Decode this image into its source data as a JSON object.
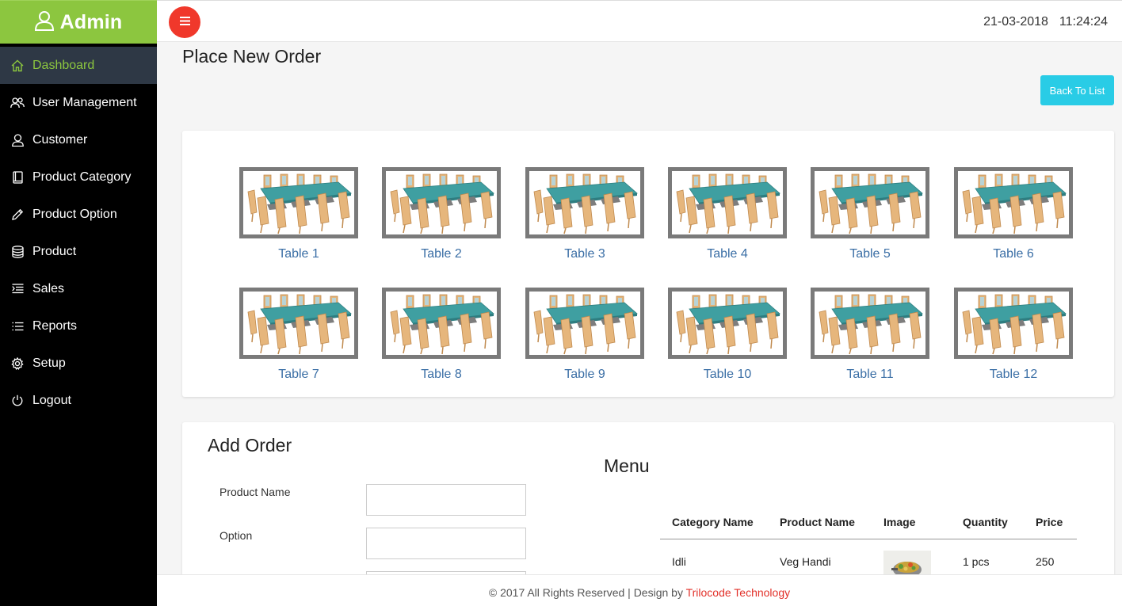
{
  "app": {
    "brand": "Admin"
  },
  "sidebar": {
    "items": [
      {
        "label": "Dashboard",
        "icon": "home-icon",
        "active": true
      },
      {
        "label": "User Management",
        "icon": "users-icon"
      },
      {
        "label": "Customer",
        "icon": "user-icon"
      },
      {
        "label": "Product Category",
        "icon": "book-icon"
      },
      {
        "label": "Product Option",
        "icon": "pencil-icon"
      },
      {
        "label": "Product",
        "icon": "database-icon"
      },
      {
        "label": "Sales",
        "icon": "list-indent-icon"
      },
      {
        "label": "Reports",
        "icon": "list-icon"
      },
      {
        "label": "Setup",
        "icon": "gear-icon"
      },
      {
        "label": "Logout",
        "icon": "power-icon"
      }
    ]
  },
  "header": {
    "date": "21-03-2018",
    "time": "11:24:24"
  },
  "page": {
    "title": "Place New Order",
    "back_button": "Back To List"
  },
  "tables": [
    {
      "label": "Table 1"
    },
    {
      "label": "Table 2"
    },
    {
      "label": "Table 3"
    },
    {
      "label": "Table 4"
    },
    {
      "label": "Table 5"
    },
    {
      "label": "Table 6"
    },
    {
      "label": "Table 7"
    },
    {
      "label": "Table 8"
    },
    {
      "label": "Table 9"
    },
    {
      "label": "Table 10"
    },
    {
      "label": "Table 11"
    },
    {
      "label": "Table 12"
    }
  ],
  "add_order": {
    "title": "Add Order",
    "fields": [
      {
        "label": "Product Name",
        "value": ""
      },
      {
        "label": "Option",
        "value": ""
      }
    ]
  },
  "menu": {
    "title": "Menu",
    "columns": [
      "Category Name",
      "Product Name",
      "Image",
      "Quantity",
      "Price"
    ],
    "rows": [
      {
        "category": "Idli",
        "product": "Veg Handi",
        "quantity": "1 pcs",
        "price": "250"
      }
    ]
  },
  "footer": {
    "text": "© 2017 All Rights Reserved | Design by ",
    "link": "Trilocode Technology"
  },
  "colors": {
    "brand_green": "#8cc63f",
    "accent_cyan": "#29cce6",
    "menu_red": "#f0382b",
    "link_blue": "#3a6ea5"
  }
}
